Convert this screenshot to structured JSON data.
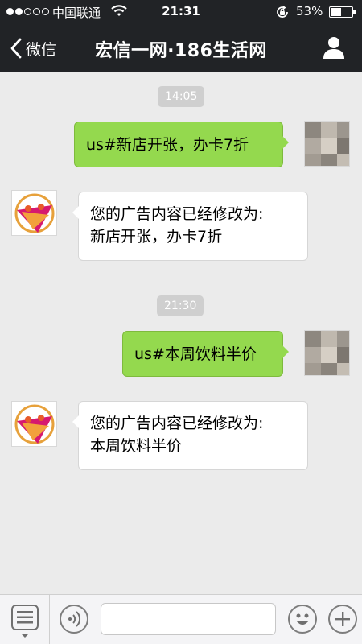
{
  "status_bar": {
    "carrier": "中国联通",
    "time": "21:31",
    "battery_percent": "53%",
    "battery_level": 0.53,
    "signal_bars": 2,
    "signal_total": 5
  },
  "nav": {
    "back_label": "微信",
    "title": "宏信一网·186生活网",
    "profile_icon": "person-icon"
  },
  "chat": {
    "messages": [
      {
        "type": "timestamp",
        "text": "14:05"
      },
      {
        "type": "outgoing",
        "text": "us#新店开张，办卡7折"
      },
      {
        "type": "incoming",
        "lines": [
          "您的广告内容已经修改为:",
          "新店开张，办卡7折"
        ]
      },
      {
        "type": "timestamp",
        "text": "21:30"
      },
      {
        "type": "outgoing",
        "text": "us#本周饮料半价"
      },
      {
        "type": "incoming",
        "lines": [
          "您的广告内容已经修改为:",
          "本周饮料半价"
        ]
      }
    ]
  },
  "input_bar": {
    "menu_icon": "menu-list-icon",
    "voice_icon": "voice-icon",
    "emoji_icon": "emoji-icon",
    "add_icon": "plus-icon",
    "input_value": "",
    "input_placeholder": ""
  },
  "colors": {
    "nav_background": "#212326",
    "chat_background": "#ebebeb",
    "outgoing_bubble": "#94d94e",
    "incoming_bubble": "#ffffff",
    "timestamp_background": "#cfcfcf"
  }
}
